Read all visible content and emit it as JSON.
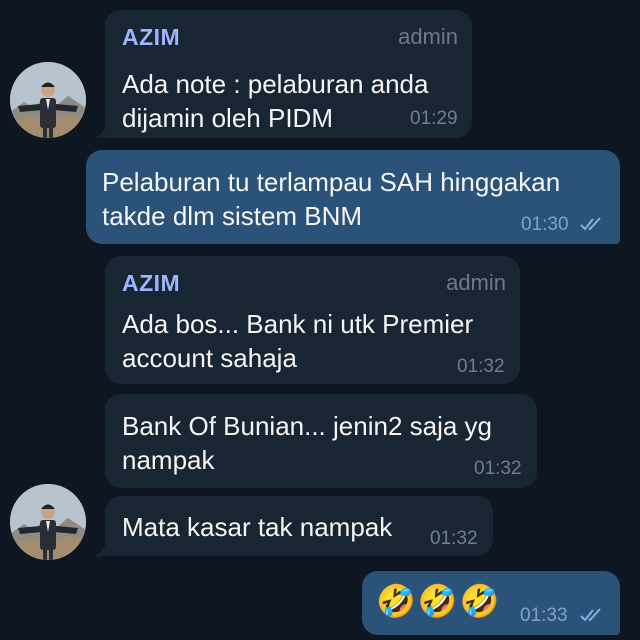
{
  "messages": [
    {
      "sender": "AZIM",
      "role": "admin",
      "lines": [
        "Ada note : pelaburan anda",
        "dijamin oleh PIDM"
      ],
      "time": "01:29"
    },
    {
      "lines": [
        "Pelaburan tu terlampau SAH hinggakan",
        "takde dlm sistem BNM"
      ],
      "time": "01:30",
      "status": "read-double-check-icon"
    },
    {
      "sender": "AZIM",
      "role": "admin",
      "lines": [
        "Ada bos... Bank ni utk Premier",
        "account sahaja"
      ],
      "time": "01:32"
    },
    {
      "lines": [
        "Bank Of Bunian... jenin2 saja yg",
        "nampak"
      ],
      "time": "01:32"
    },
    {
      "lines": [
        "Mata kasar tak nampak"
      ],
      "time": "01:32"
    },
    {
      "text": "🤣🤣🤣",
      "time": "01:33",
      "status": "read-double-check-icon"
    }
  ],
  "colors": {
    "background": "#0e1621",
    "incoming_bubble": "#182533",
    "outgoing_bubble": "#2b5278",
    "sender_name": "#9eb4ff",
    "check_marks": "#7fb2e8"
  },
  "icons": {
    "avatar": "user-avatar-icon",
    "read_status": "double-check-icon"
  }
}
